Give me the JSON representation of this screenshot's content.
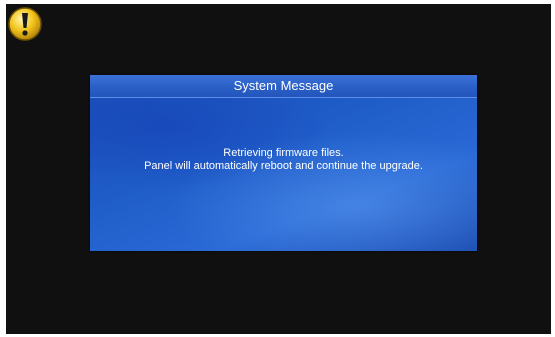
{
  "dialog": {
    "title": "System Message",
    "message_line1": "Retrieving firmware files.",
    "message_line2": "Panel will automatically reboot and continue the upgrade."
  },
  "icons": {
    "status": "warning-icon"
  },
  "colors": {
    "screen_background": "#101010",
    "dialog_blue": "#1f5cc8",
    "warning_yellow": "#f2c51c"
  }
}
